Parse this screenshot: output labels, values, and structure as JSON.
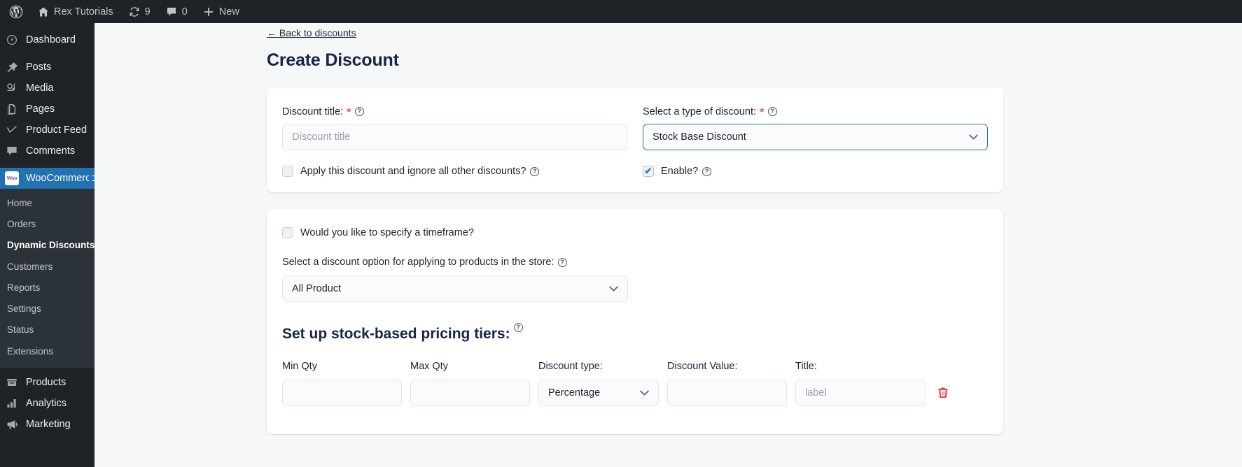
{
  "adminbar": {
    "wp_logo": "wordpress-logo-icon",
    "site_name": "Rex Tutorials",
    "updates_count": "9",
    "comments_count": "0",
    "new_label": "New"
  },
  "sidebar": {
    "items": [
      {
        "label": "Dashboard",
        "icon": "dashboard-icon"
      },
      {
        "label": "Posts",
        "icon": "pin-icon"
      },
      {
        "label": "Media",
        "icon": "media-icon"
      },
      {
        "label": "Pages",
        "icon": "pages-icon"
      },
      {
        "label": "Product Feed",
        "icon": "product-feed-icon"
      },
      {
        "label": "Comments",
        "icon": "comments-icon"
      },
      {
        "label": "WooCommerce",
        "icon": "woocommerce-icon"
      },
      {
        "label": "Products",
        "icon": "products-icon"
      },
      {
        "label": "Analytics",
        "icon": "analytics-icon"
      },
      {
        "label": "Marketing",
        "icon": "marketing-icon"
      }
    ],
    "woo_submenu": [
      "Home",
      "Orders",
      "Dynamic Discounts",
      "Customers",
      "Reports",
      "Settings",
      "Status",
      "Extensions"
    ],
    "woo_badge_text": "Woo",
    "active_item": "WooCommerce",
    "current_subitem": "Dynamic Discounts",
    "accent_color": "#2271b1"
  },
  "page": {
    "back_link": "← Back to discounts",
    "title": "Create Discount"
  },
  "card_main": {
    "discount_title": {
      "label": "Discount title:",
      "required_mark": "*",
      "help_icon": "help-icon",
      "placeholder": "Discount title",
      "value": ""
    },
    "discount_type": {
      "label": "Select a type of discount:",
      "required_mark": "*",
      "help_icon": "help-icon",
      "selected": "Stock Base Discount",
      "options": [
        "Stock Base Discount"
      ]
    },
    "ignore_others": {
      "label": "Apply this discount and ignore all other discounts?",
      "checked": false,
      "help_icon": "help-icon"
    },
    "enable": {
      "label": "Enable?",
      "checked": true,
      "check_glyph": "✔",
      "help_icon": "help-icon"
    }
  },
  "card_rules": {
    "timeframe": {
      "label": "Would you like to specify a timeframe?",
      "checked": false
    },
    "apply_option": {
      "label": "Select a discount option for applying to products in the store:",
      "help_icon": "help-icon",
      "selected": "All Product",
      "options": [
        "All Product"
      ]
    },
    "tiers_heading": "Set up stock-based pricing tiers:",
    "tiers_heading_help": "help-icon",
    "columns": [
      "Min Qty",
      "Max Qty",
      "Discount type:",
      "Discount Value:",
      "Title:"
    ],
    "rows": [
      {
        "min_qty": "",
        "max_qty": "",
        "discount_type": "Percentage",
        "discount_value": "",
        "title_placeholder": "label",
        "title_value": "",
        "delete_icon": "trash-icon",
        "delete_color": "#e3342f"
      }
    ]
  }
}
